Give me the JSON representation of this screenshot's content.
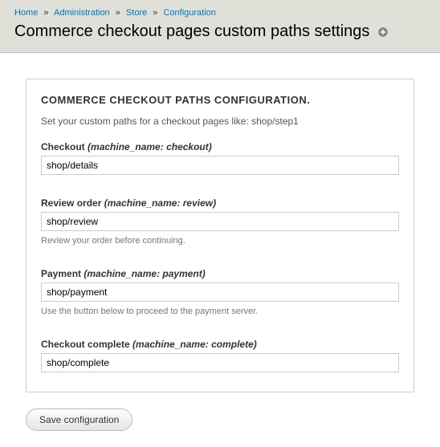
{
  "breadcrumb": {
    "home": "Home",
    "admin": "Administration",
    "store": "Store",
    "config": "Configuration",
    "sep": "»"
  },
  "page_title": "Commerce checkout pages custom paths settings",
  "panel": {
    "title": "COMMERCE CHECKOUT PATHS CONFIGURATION.",
    "description": "Set your custom paths for a checkout pages like: shop/step1"
  },
  "fields": {
    "checkout": {
      "label": "Checkout",
      "machine": "(machine_name: checkout)",
      "value": "shop/details",
      "hint": ""
    },
    "review": {
      "label": "Review order",
      "machine": "(machine_name: review)",
      "value": "shop/review",
      "hint": "Review your order before continuing."
    },
    "payment": {
      "label": "Payment",
      "machine": "(machine_name: payment)",
      "value": "shop/payment",
      "hint": "Use the button below to proceed to the payment server."
    },
    "complete": {
      "label": "Checkout complete",
      "machine": "(machine_name: complete)",
      "value": "shop/complete",
      "hint": ""
    }
  },
  "actions": {
    "save": "Save configuration"
  }
}
